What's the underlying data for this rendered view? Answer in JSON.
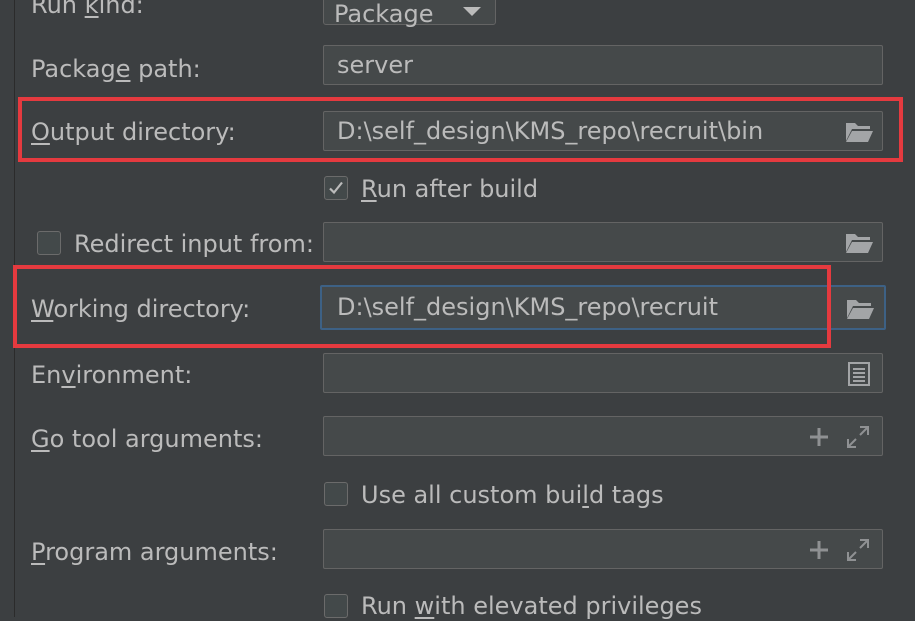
{
  "run_kind": {
    "label_pre": "Run ",
    "label_mn": "k",
    "label_post": "ind:",
    "value": "Package"
  },
  "package_path": {
    "label_pre": "Packag",
    "label_mn": "e",
    "label_post": " path:",
    "value": "server"
  },
  "output_directory": {
    "label_mn": "O",
    "label_post": "utput directory:",
    "value": "D:\\self_design\\KMS_repo\\recruit\\bin"
  },
  "run_after_build": {
    "label_mn": "R",
    "label_post": "un after build",
    "checked": true
  },
  "redirect_input": {
    "label": "Redirect input from:",
    "checked": false,
    "value": ""
  },
  "working_directory": {
    "label_mn": "W",
    "label_post": "orking directory:",
    "value": "D:\\self_design\\KMS_repo\\recruit"
  },
  "environment": {
    "label_pre": "En",
    "label_mn": "v",
    "label_post": "ironment:",
    "value": ""
  },
  "go_tool_arguments": {
    "label_mn": "G",
    "label_post": "o tool arguments:",
    "value": ""
  },
  "custom_build_tags": {
    "label_pre": "Use all custom bui",
    "label_mn": "l",
    "label_post": "d tags",
    "checked": false
  },
  "program_arguments": {
    "label_mn": "P",
    "label_post": "rogram arguments:",
    "value": ""
  },
  "elevated_privileges": {
    "label_pre": "Run ",
    "label_mn": "w",
    "label_post": "ith elevated privileges",
    "checked": false
  },
  "icons": [
    "folder-icon",
    "document-icon",
    "plus-icon",
    "expand-icon",
    "checkmark-icon",
    "dropdown-arrow-icon"
  ],
  "colors": {
    "background": "#3c3f41",
    "field": "#45494a",
    "border": "#646464",
    "focus": "#3d6185",
    "highlight": "#e53a3f",
    "text": "#bbbbbb"
  }
}
